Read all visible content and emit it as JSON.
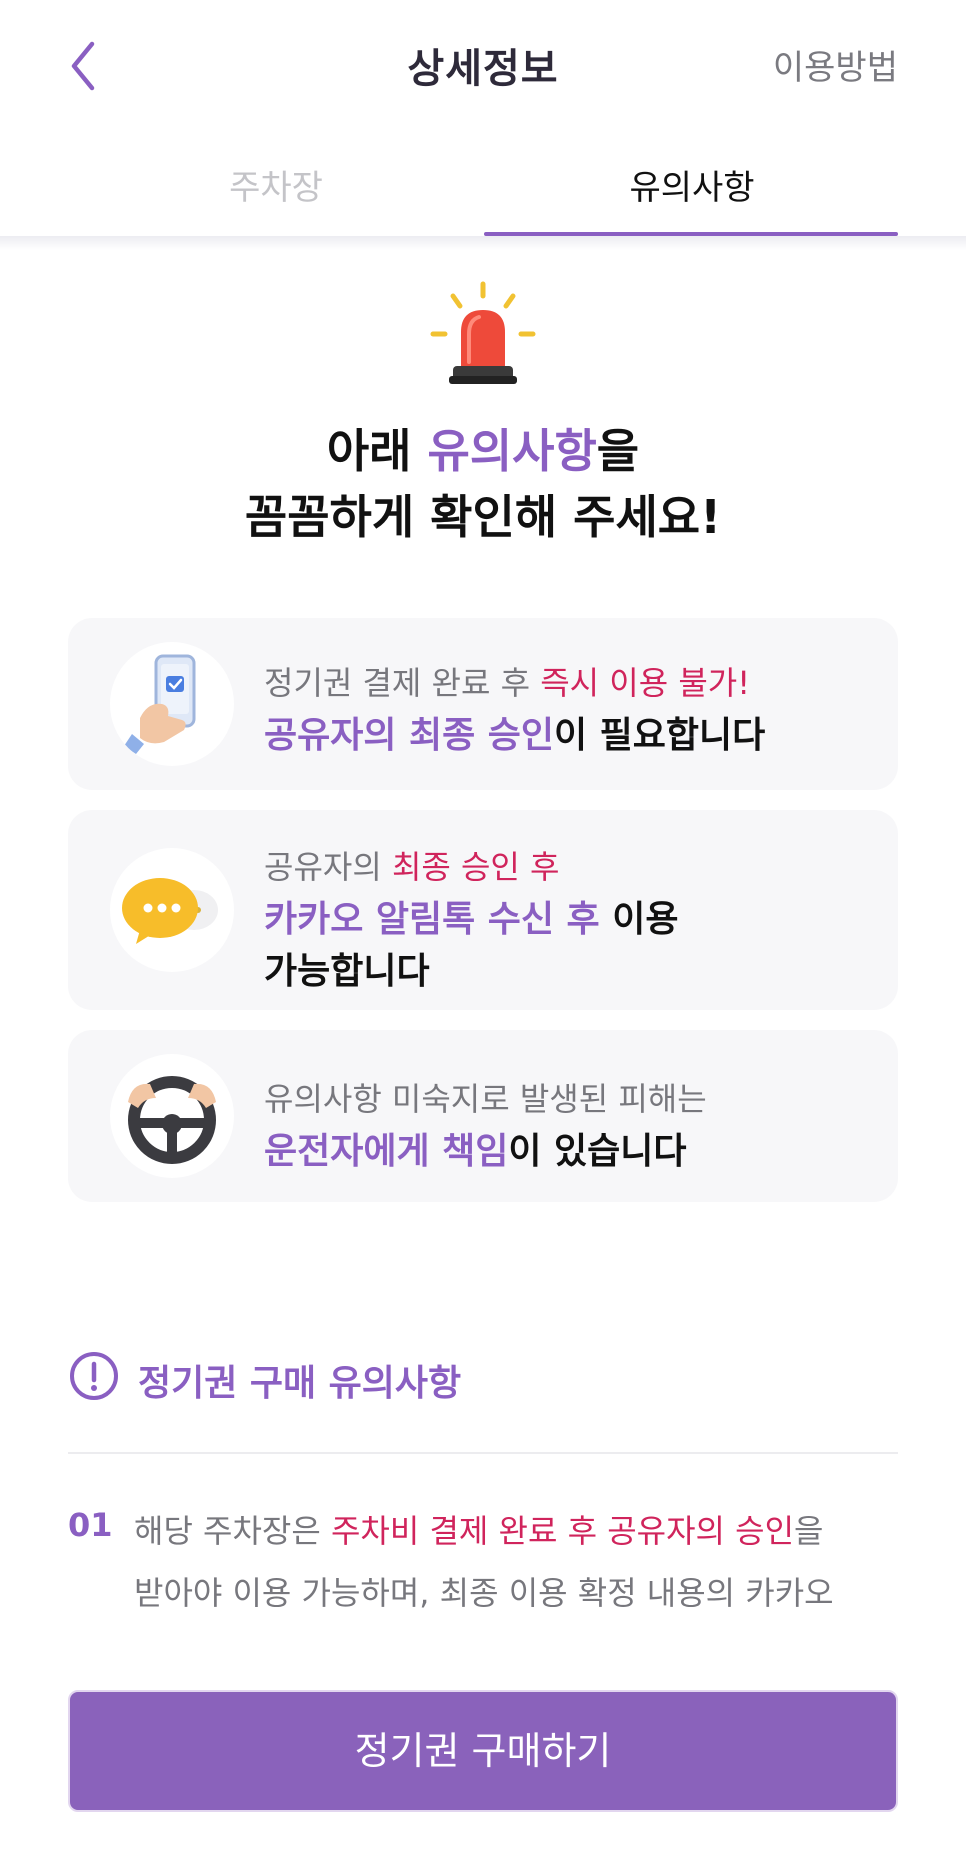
{
  "header": {
    "back_icon": "chevron-left-icon",
    "title": "상세정보",
    "howto_label": "이용방법"
  },
  "tabs": [
    {
      "label": "주차장",
      "active": false
    },
    {
      "label": "유의사항",
      "active": true
    }
  ],
  "hero": {
    "icon": "siren-icon",
    "line1_pre": "아래 ",
    "line1_accent": "유의사항",
    "line1_post": "을",
    "line2": "꼼꼼하게 확인해 주세요!"
  },
  "cards": [
    {
      "icon": "phone-hand-icon",
      "line1_plain": "정기권 결제 완료 후 ",
      "line1_pink": "즉시 이용 불가!",
      "line2_purple": "공유자의 최종 승인",
      "line2_plain": "이 필요합니다"
    },
    {
      "icon": "chat-bubble-icon",
      "line1_plain": "공유자의 ",
      "line1_pink": "최종 승인 후",
      "line2_purple": "카카오 알림톡 수신 후",
      "line2_plain": " 이용",
      "line3_plain": "가능합니다"
    },
    {
      "icon": "steering-wheel-icon",
      "line1_plain": "유의사항 미숙지로 발생된 피해는",
      "line2_purple": "운전자에게 책임",
      "line2_plain": "이 있습니다"
    }
  ],
  "purchase_notice": {
    "icon": "info-circle-icon",
    "title": "정기권 구매 유의사항",
    "items": [
      {
        "number": "01",
        "text_pre": "해당 주차장은 ",
        "text_pink": "주차비 결제 완료 후 공유자의 승인",
        "text_post": "을",
        "text_line2": "받아야 이용 가능하며, 최종 이용 확정 내용의 카카오"
      }
    ]
  },
  "buy_button": {
    "label": "정기권 구매하기"
  },
  "colors": {
    "accent_purple": "#8a5fc2",
    "accent_pink": "#d0245c",
    "button_bg": "#8a62bb",
    "card_bg": "#f7f7f9"
  }
}
